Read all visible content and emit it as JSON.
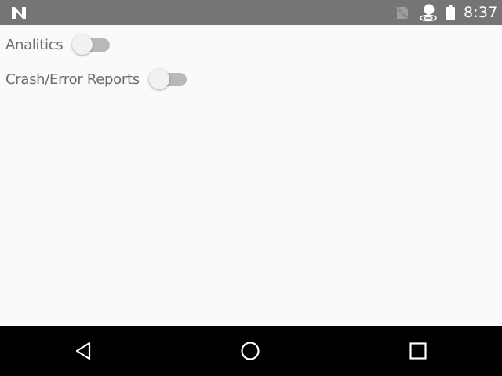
{
  "status_bar": {
    "time": "8:37",
    "icons": [
      "notification-n-icon",
      "no-sim-icon",
      "cast-icon",
      "battery-icon"
    ]
  },
  "settings": [
    {
      "label": "Analitics",
      "enabled": false
    },
    {
      "label": "Crash/Error Reports",
      "enabled": false
    }
  ],
  "nav_bar": {
    "buttons": [
      "back-icon",
      "home-icon",
      "recents-icon"
    ]
  },
  "colors": {
    "status_bar": "#757575",
    "background": "#fafafa",
    "switch_track_off": "#b9b9b9",
    "switch_thumb_off": "#f1f1f1",
    "nav_bar": "#000000"
  }
}
